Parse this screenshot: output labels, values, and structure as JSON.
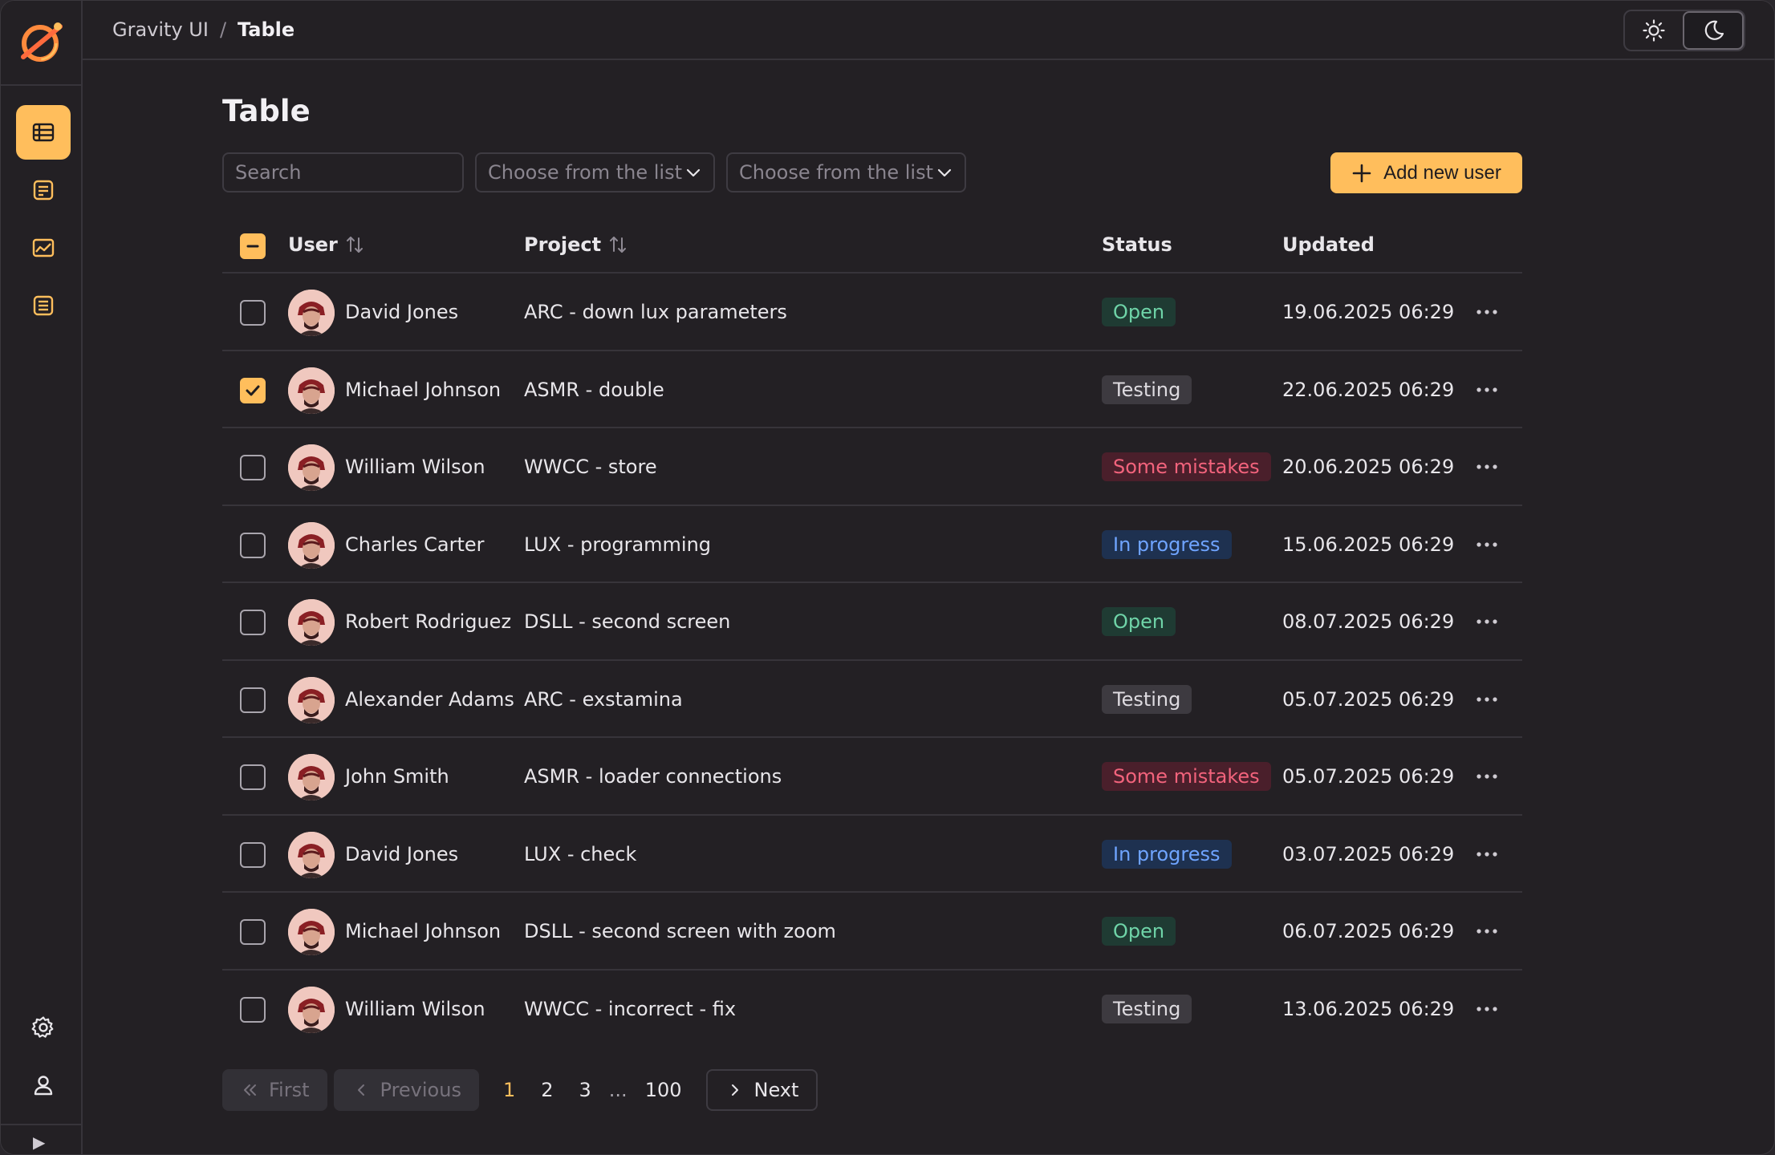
{
  "header": {
    "breadcrumb_root": "Gravity UI",
    "breadcrumb_sep": "/",
    "breadcrumb_current": "Table"
  },
  "main": {
    "title": "Table",
    "search_placeholder": "Search",
    "filter1_placeholder": "Choose from the list",
    "filter2_placeholder": "Choose from the list",
    "add_button": "Add new user"
  },
  "table": {
    "columns": {
      "user": "User",
      "project": "Project",
      "status": "Status",
      "updated": "Updated"
    },
    "rows": [
      {
        "user": "David Jones",
        "project": "ARC - down lux parameters",
        "status": "Open",
        "updated": "19.06.2025 06:29",
        "checked": false
      },
      {
        "user": "Michael Johnson",
        "project": "ASMR - double",
        "status": "Testing",
        "updated": "22.06.2025 06:29",
        "checked": true
      },
      {
        "user": "William Wilson",
        "project": "WWCC - store",
        "status": "Some mistakes",
        "updated": "20.06.2025 06:29",
        "checked": false
      },
      {
        "user": "Charles Carter",
        "project": "LUX - programming",
        "status": "In progress",
        "updated": "15.06.2025 06:29",
        "checked": false
      },
      {
        "user": "Robert Rodriguez",
        "project": "DSLL - second screen",
        "status": "Open",
        "updated": "08.07.2025 06:29",
        "checked": false
      },
      {
        "user": "Alexander Adams",
        "project": "ARC - exstamina",
        "status": "Testing",
        "updated": "05.07.2025 06:29",
        "checked": false
      },
      {
        "user": "John Smith",
        "project": "ASMR - loader connections",
        "status": "Some mistakes",
        "updated": "05.07.2025 06:29",
        "checked": false
      },
      {
        "user": "David Jones",
        "project": "LUX - check",
        "status": "In progress",
        "updated": "03.07.2025 06:29",
        "checked": false
      },
      {
        "user": "Michael Johnson",
        "project": "DSLL - second screen with zoom",
        "status": "Open",
        "updated": "06.07.2025 06:29",
        "checked": false
      },
      {
        "user": "William Wilson",
        "project": "WWCC - incorrect - fix",
        "status": "Testing",
        "updated": "13.06.2025 06:29",
        "checked": false
      }
    ]
  },
  "pagination": {
    "first": "First",
    "previous": "Previous",
    "pages": [
      "1",
      "2",
      "3"
    ],
    "dots": "...",
    "last_page": "100",
    "next": "Next",
    "current": "1"
  },
  "colors": {
    "accent": "#ffbe5c",
    "background": "#232024"
  }
}
